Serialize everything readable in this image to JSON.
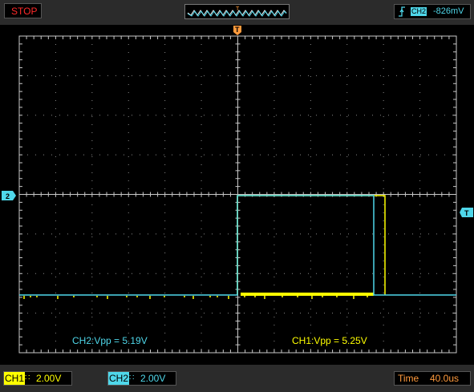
{
  "run_status": "STOP",
  "trigger": {
    "marker": "T",
    "edge_icon": "rising-edge-icon",
    "source": "CH2",
    "level": "-826mV"
  },
  "markers": {
    "ch2_ground": "2",
    "trigger_level": "T"
  },
  "measurements": {
    "ch2": "CH2:Vpp = 5.19V",
    "ch1": "CH1:Vpp = 5.25V"
  },
  "channels": {
    "ch1": {
      "label": "CH1",
      "coupling": "∷",
      "scale": "2.00V",
      "color": "#ffff00"
    },
    "ch2": {
      "label": "CH2",
      "coupling": "∷",
      "scale": "2.00V",
      "color": "#4fd7ea"
    }
  },
  "time": {
    "label": "Time",
    "value": "40.0us"
  },
  "colors": {
    "stop": "#ff2a2a",
    "ch1": "#ffff00",
    "ch2": "#4fd7ea",
    "trigger_marker": "#ff9a3c",
    "grid": "#c8c8c8"
  }
}
